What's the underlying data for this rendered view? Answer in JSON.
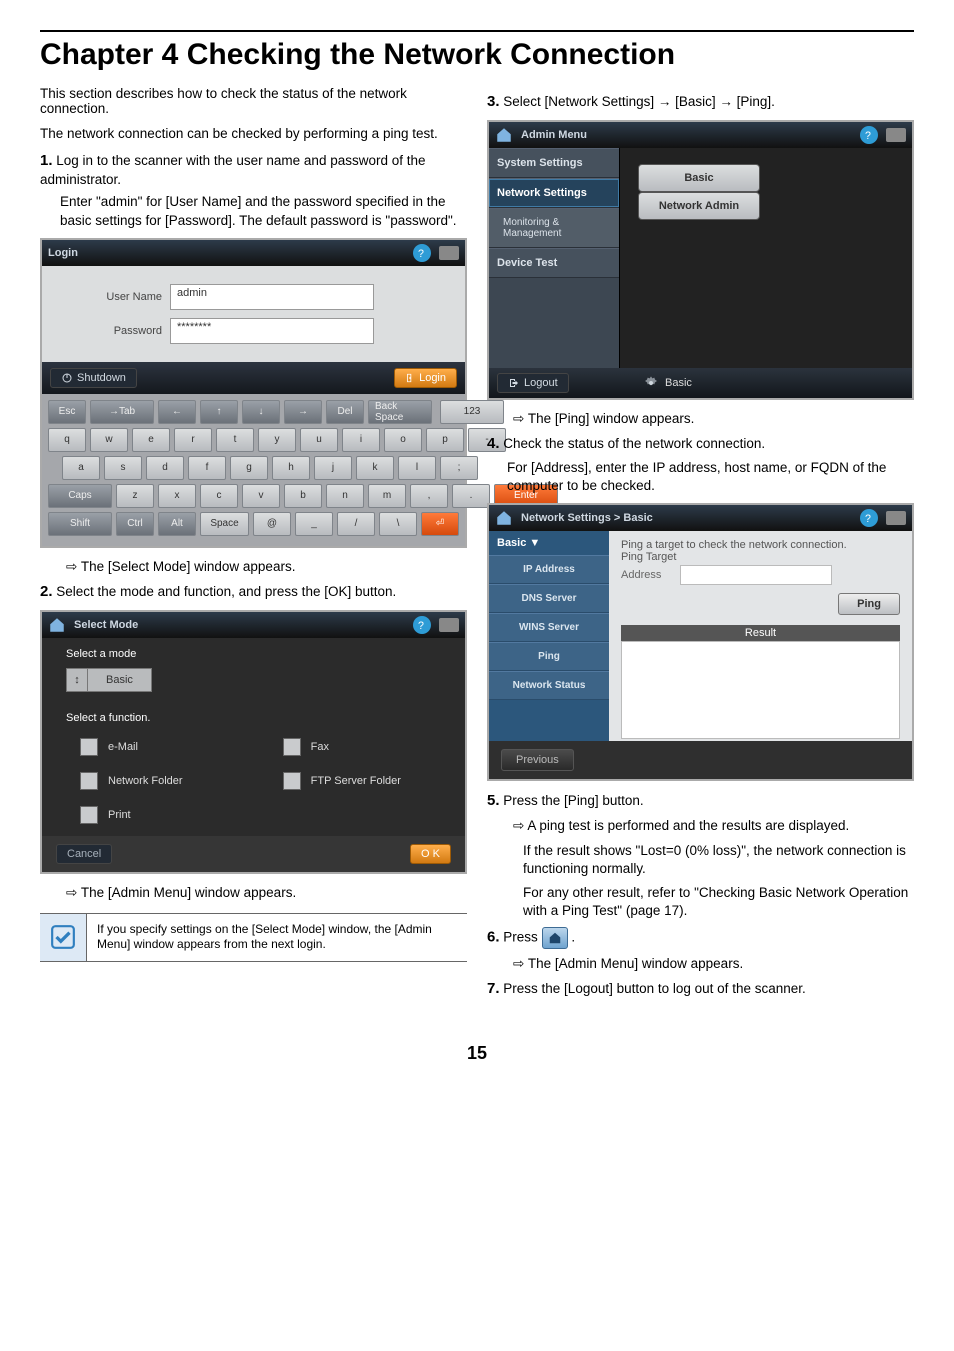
{
  "page": {
    "title": "Chapter 4   Checking the Network Connection",
    "intro1": "This section describes how to check the status of the network connection.",
    "intro2": "The network connection can be checked by performing a ping test.",
    "pageNumber": "15"
  },
  "step1": {
    "num": "1.",
    "text": "Log in to the scanner with the user name and password of the administrator.",
    "sub": "Enter \"admin\" for [User Name] and the password specified in the basic settings for [Password]. The default password is \"password\"."
  },
  "login": {
    "title": "Login",
    "userLabel": "User Name",
    "passLabel": "Password",
    "userValue": "admin",
    "passValue": "********",
    "shutdown": "Shutdown",
    "loginBtn": "Login",
    "resultText": "The [Select Mode] window appears.",
    "keys": {
      "esc": "Esc",
      "tab": "Tab",
      "del": "Del",
      "back": "Back Space",
      "num": "123",
      "q": "q",
      "w": "w",
      "e": "e",
      "r": "r",
      "t": "t",
      "y": "y",
      "u": "u",
      "i": "i",
      "o": "o",
      "p": "p",
      "a": "a",
      "s": "s",
      "d": "d",
      "f": "f",
      "g": "g",
      "h": "h",
      "j": "j",
      "k": "k",
      "l": "l",
      "caps": "Caps",
      "z": "z",
      "x": "x",
      "c": "c",
      "v": "v",
      "b": "b",
      "n": "n",
      "m": "m",
      "enter": "Enter",
      "shift": "Shift",
      "ctrl": "Ctrl",
      "alt": "Alt",
      "space": "Space",
      "at": "@",
      "dash": "-",
      "semi": ";",
      "comma": ",",
      "dot": ".",
      "slash": "/",
      "bslash": "\\",
      "under": "_"
    }
  },
  "step2": {
    "num": "2.",
    "text": "Select the mode and function, and press the [OK] button."
  },
  "selectMode": {
    "title": "Select Mode",
    "selectMode": "Select a mode",
    "modeValue": "Basic",
    "selectFunc": "Select a function.",
    "funcs": {
      "email": "e-Mail",
      "fax": "Fax",
      "netfolder": "Network Folder",
      "ftp": "FTP Server Folder",
      "print": "Print"
    },
    "cancel": "Cancel",
    "ok": "O K",
    "result": "The [Admin Menu] window appears."
  },
  "note": "If you specify settings on the [Select Mode] window, the [Admin Menu] window appears from the next login.",
  "step3": {
    "num": "3.",
    "text": "Select [Network Settings] → [Basic] → [Ping]."
  },
  "adminMenu": {
    "title": "Admin Menu",
    "items": {
      "system": "System Settings",
      "network": "Network Settings",
      "monitoring": "Monitoring & Management",
      "device": "Device Test"
    },
    "basicBtn": "Basic",
    "netAdminBtn": "Network Admin",
    "logout": "Logout",
    "breadcrumb": "Basic",
    "result": "The [Ping] window appears."
  },
  "step4": {
    "num": "4.",
    "text": "Check the status of the network connection.",
    "sub": "For [Address], enter the IP address, host name, or FQDN of the computer to be checked."
  },
  "ping": {
    "breadcrumb": "Network Settings > Basic",
    "sideHeader": "Basic ▼",
    "items": {
      "ip": "IP Address",
      "dns": "DNS Server",
      "wins": "WINS Server",
      "ping": "Ping",
      "net": "Network Status"
    },
    "instr": "Ping a target to check the network connection.",
    "targetLabel": "Ping Target",
    "addrLabel": "Address",
    "pingBtn": "Ping",
    "resultHdr": "Result",
    "previous": "Previous"
  },
  "step5": {
    "num": "5.",
    "text": "Press the [Ping] button.",
    "r1": "A ping test is performed and the results are displayed.",
    "r2": "If the result shows \"Lost=0 (0% loss)\", the network connection is functioning normally.",
    "r3": "For any other result, refer to \"Checking Basic Network Operation with a Ping Test\" (page 17)."
  },
  "step6": {
    "num": "6.",
    "textBefore": "Press ",
    "textAfter": " .",
    "result": "The [Admin Menu] window appears."
  },
  "step7": {
    "num": "7.",
    "text": "Press the [Logout] button to log out of the scanner."
  }
}
